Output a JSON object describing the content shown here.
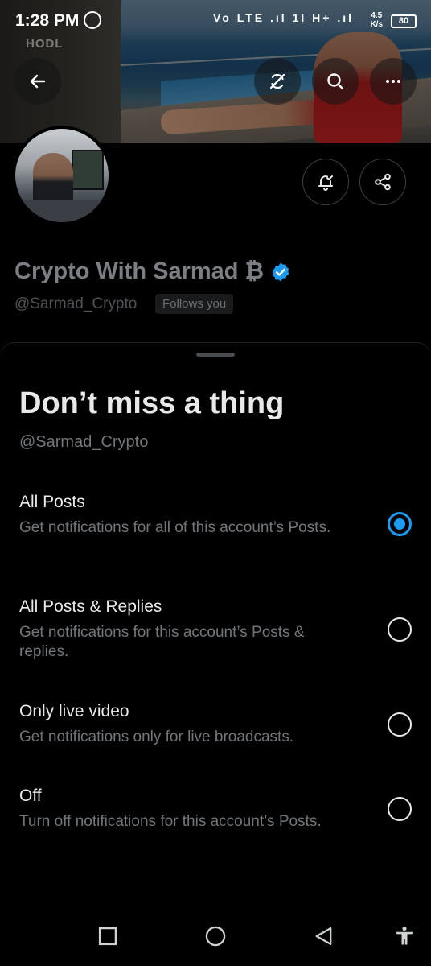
{
  "status_bar": {
    "time": "1:28 PM",
    "indicators": "Vo LTE .ıl 1l H+ .ıl",
    "speed_value": "4.5",
    "speed_unit": "K/s",
    "battery": "80"
  },
  "banner": {
    "sign_text": "HODL"
  },
  "header_actions": {
    "back_icon": "arrow-left-icon",
    "refresh_icon": "refresh-off-icon",
    "search_icon": "search-icon",
    "more_icon": "more-horizontal-icon"
  },
  "profile": {
    "name": "Crypto With Sarmad ₿",
    "handle": "@Sarmad_Crypto",
    "follows_badge": "Follows you",
    "notify_icon": "bell-check-icon",
    "share_icon": "share-icon"
  },
  "sheet": {
    "title": "Don’t miss a thing",
    "handle": "@Sarmad_Crypto",
    "selected_option": "all_posts",
    "options": [
      {
        "id": "all_posts",
        "label": "All Posts",
        "description": "Get notifications for all of this account’s Posts."
      },
      {
        "id": "all_posts_replies",
        "label": "All Posts & Replies",
        "description": "Get notifications for this account’s Posts & replies."
      },
      {
        "id": "only_live_video",
        "label": "Only live video",
        "description": "Get notifications only for live broadcasts."
      },
      {
        "id": "off",
        "label": "Off",
        "description": "Turn off notifications for this account’s Posts."
      }
    ]
  },
  "colors": {
    "accent": "#1d9bf0",
    "background": "#000000",
    "primary_text": "#e7e9ea",
    "secondary_text": "#71767b"
  },
  "nav_bar": {
    "recents_icon": "square-icon",
    "home_icon": "circle-icon",
    "back_icon": "triangle-back-icon",
    "accessibility_icon": "accessibility-icon"
  }
}
